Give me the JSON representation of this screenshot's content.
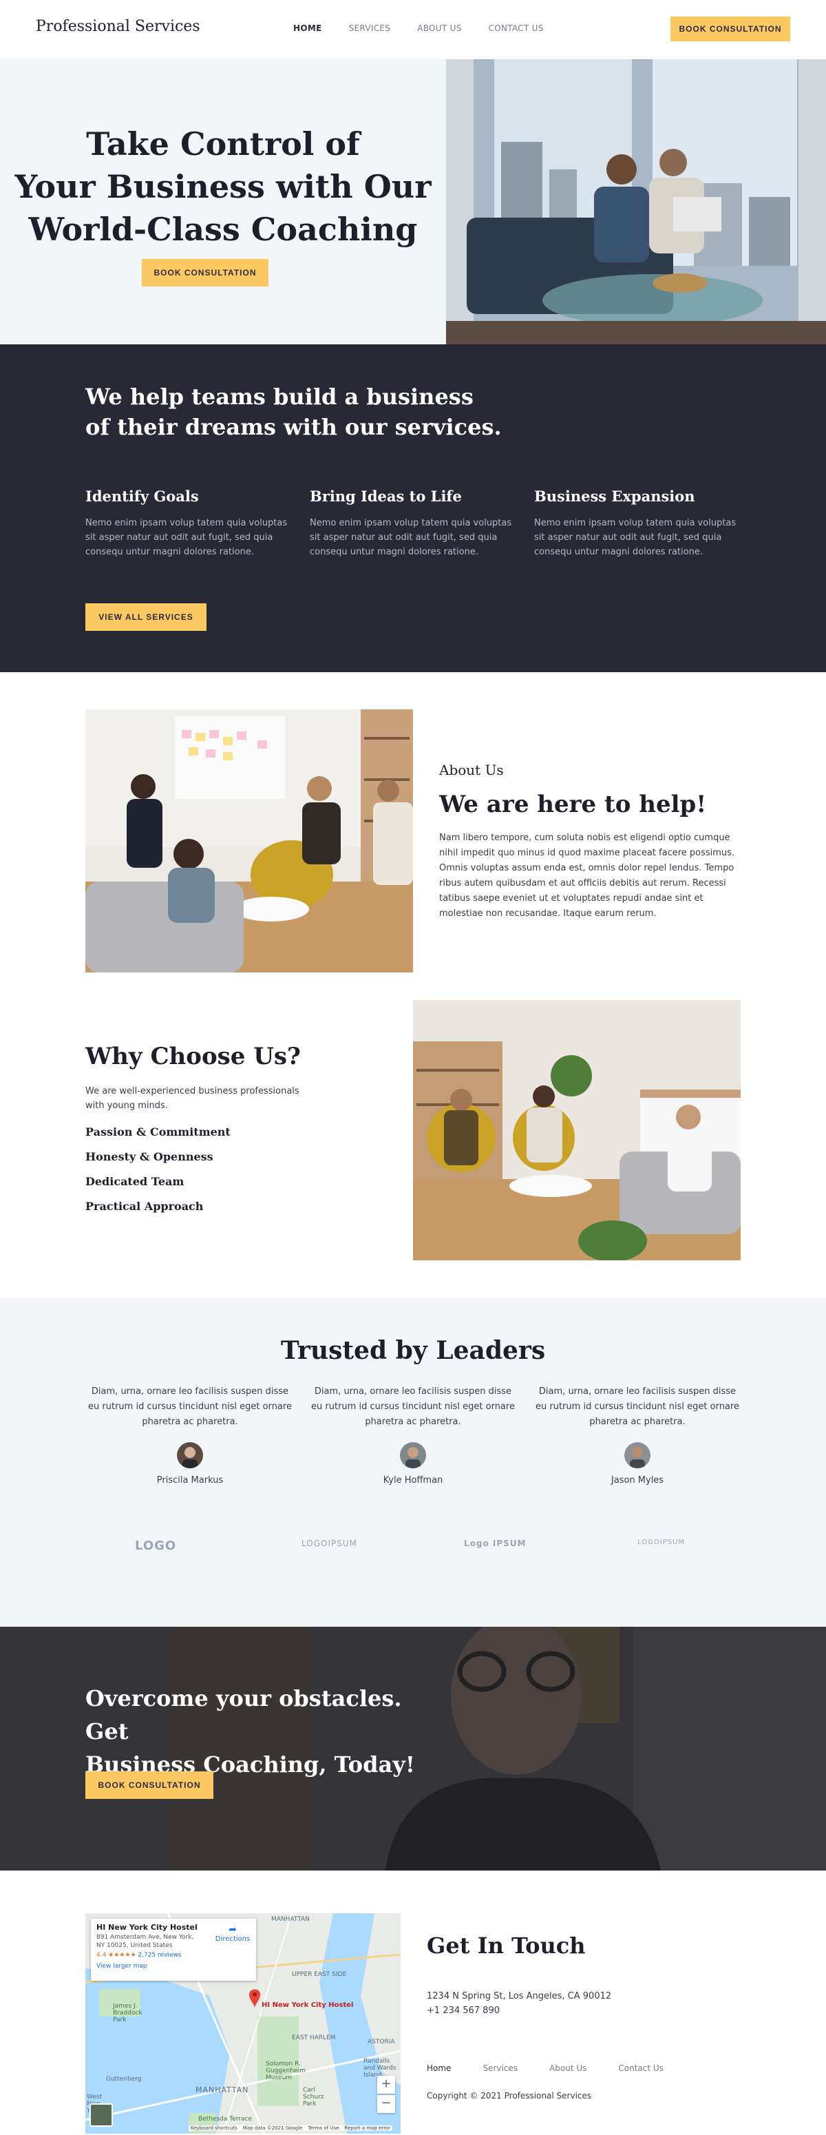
{
  "header": {
    "logo": "Professional Services",
    "nav": [
      "HOME",
      "SERVICES",
      "ABOUT US",
      "CONTACT US"
    ],
    "cta": "BOOK CONSULTATION"
  },
  "hero": {
    "title_lines": [
      "Take Control of",
      "Your Business with Our",
      "World-Class Coaching"
    ],
    "button": "BOOK CONSULTATION"
  },
  "services": {
    "title_lines": [
      "We help teams build a business",
      "of their dreams with our services."
    ],
    "items": [
      {
        "title": "Identify Goals",
        "text": "Nemo enim ipsam volup tatem quia voluptas sit asper natur aut odit aut fugit, sed quia consequ untur magni dolores ratione."
      },
      {
        "title": "Bring Ideas to Life",
        "text": "Nemo enim ipsam volup tatem quia voluptas sit asper natur aut odit aut fugit, sed quia consequ untur magni dolores ratione."
      },
      {
        "title": "Business Expansion",
        "text": "Nemo enim ipsam volup tatem quia voluptas sit asper natur aut odit aut fugit, sed quia consequ untur magni dolores ratione."
      }
    ],
    "button": "VIEW ALL SERVICES"
  },
  "about": {
    "kicker": "About Us",
    "title": "We are here to help!",
    "text": "Nam libero tempore, cum soluta nobis est eligendi optio cumque nihil impedit quo minus id quod maxime placeat facere possimus. Omnis voluptas assum enda est, omnis dolor repel lendus. Tempo ribus autem quibusdam et aut officiis debitis aut rerum. Recessi tatibus saepe eveniet ut et voluptates repudi andae sint et molestiae non recusandae. Itaque earum rerum."
  },
  "why": {
    "title": "Why Choose Us?",
    "text": "We are well-experienced business professionals with young minds.",
    "items": [
      "Passion & Commitment",
      "Honesty & Openness",
      "Dedicated Team",
      "Practical Approach"
    ]
  },
  "testimonials": {
    "title": "Trusted by Leaders",
    "items": [
      {
        "text": "Diam, urna, ornare leo facilisis suspen disse eu rutrum id cursus tincidunt nisl eget ornare pharetra ac pharetra.",
        "name": "Priscila Markus"
      },
      {
        "text": "Diam, urna, ornare leo facilisis suspen disse eu rutrum id cursus tincidunt nisl eget ornare pharetra ac pharetra.",
        "name": "Kyle Hoffman"
      },
      {
        "text": "Diam, urna, ornare leo facilisis suspen disse eu rutrum id cursus tincidunt nisl eget ornare pharetra ac pharetra.",
        "name": "Jason Myles"
      }
    ],
    "logos": [
      "LOGO",
      "LOGOIPSUM",
      "Logo IPSUM",
      "LOGOIPSUM"
    ]
  },
  "cta": {
    "title_lines": [
      "Overcome your obstacles. Get",
      "Business Coaching, Today!"
    ],
    "button": "BOOK CONSULTATION"
  },
  "map": {
    "place": "HI New York City Hostel",
    "address": "891 Amsterdam Ave, New York, NY 10025, United States",
    "rating": "4.4 ★★★★★",
    "reviews": "2,725 reviews",
    "larger": "View larger map",
    "directions": "Directions",
    "pin_label": "HI New York City Hostel",
    "labels": [
      "MANHATTAN",
      "UPPER EAST SIDE",
      "James J. Braddock Park",
      "Guttenberg",
      "West New York",
      "ASTORIA",
      "Randalls and Wards Island",
      "EAST HARLEM",
      "Solomon R. Guggenheim Museum",
      "Carl Schurz Park",
      "Bethesda Terrace",
      "MANHATTAN"
    ],
    "footer": [
      "Keyboard shortcuts",
      "Map data ©2021 Google",
      "Terms of Use",
      "Report a map error"
    ],
    "zoom_in": "+",
    "zoom_out": "−"
  },
  "contact": {
    "title": "Get In Touch",
    "address": "1234 N Spring St, Los Angeles, CA 90012",
    "phone": "+1 234 567 890",
    "footer_nav": [
      "Home",
      "Services",
      "About Us",
      "Contact Us"
    ],
    "copyright": "Copyright © 2021 Professional Services"
  },
  "colors": {
    "accent": "#fcc862",
    "dark": "#292936",
    "light_bg": "#f3f6f9"
  }
}
